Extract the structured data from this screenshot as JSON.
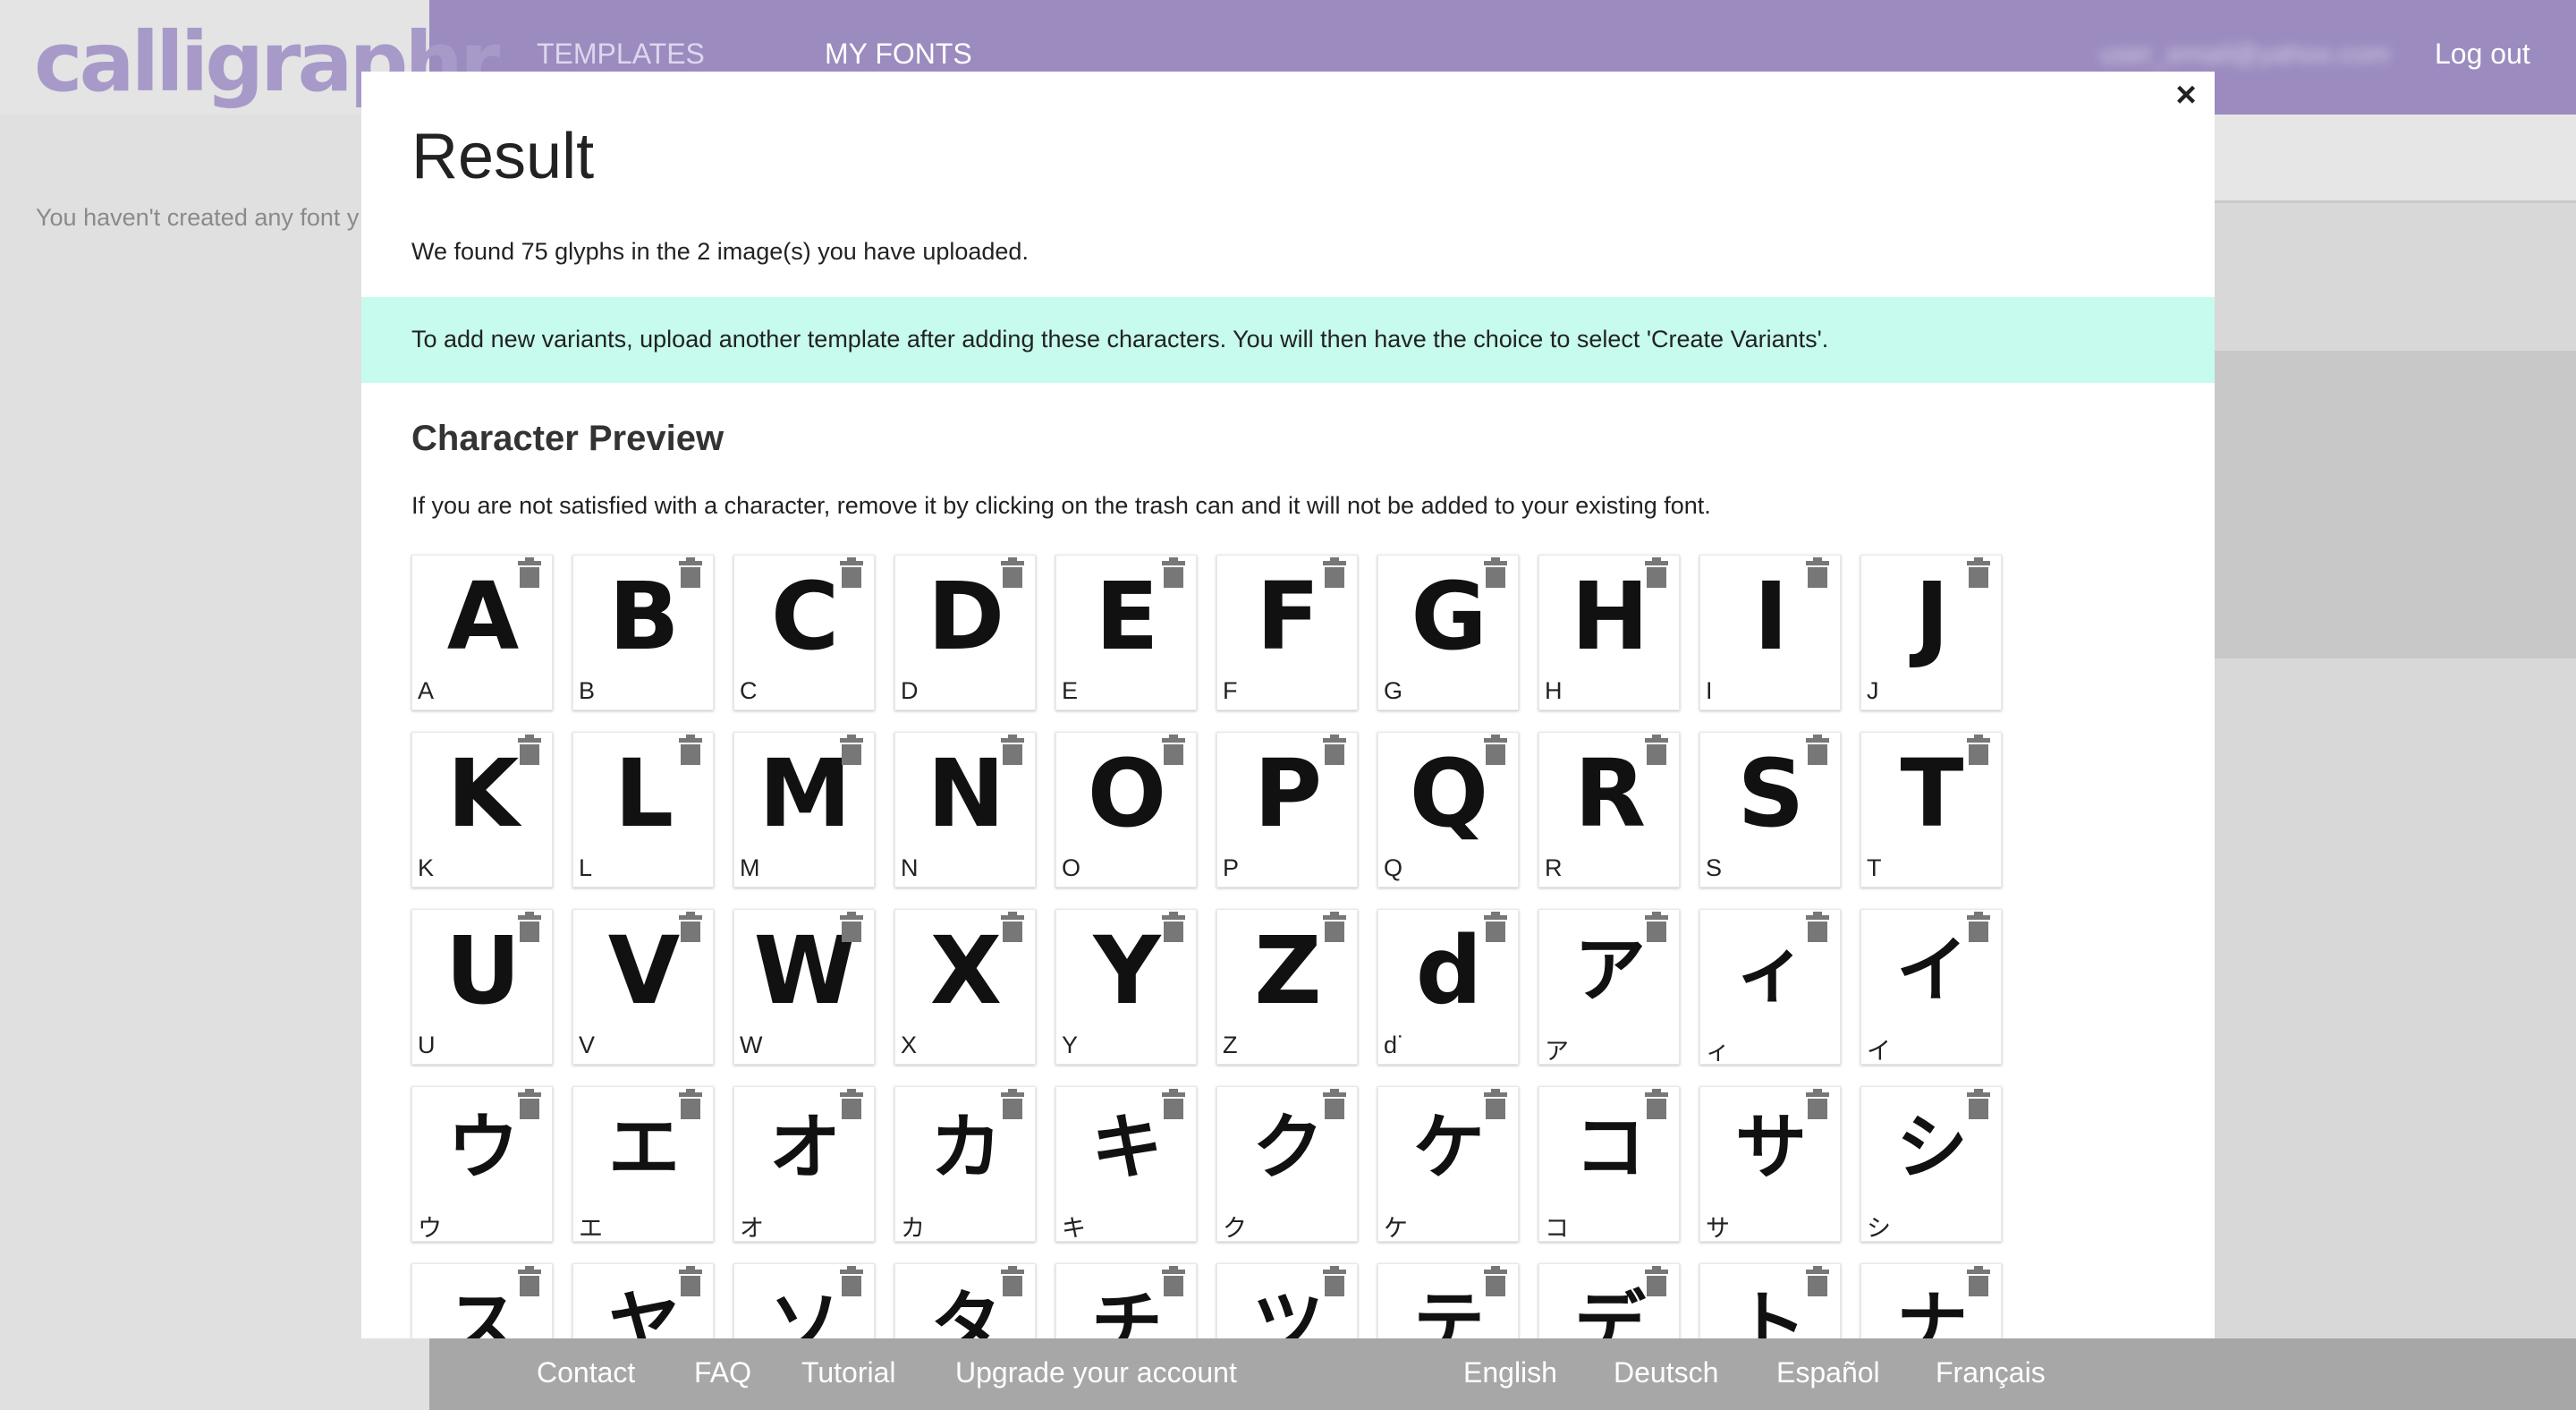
{
  "app": {
    "logo": "calligraphr",
    "nav": {
      "templates": "TEMPLATES",
      "my_fonts": "MY FONTS"
    },
    "user_email": "user_email@yahoo.com",
    "logout": "Log out",
    "empty_message": "You haven't created any font y"
  },
  "modal": {
    "title": "Result",
    "found_text": "We found 75 glyphs in the 2 image(s) you have uploaded.",
    "info_text": "To add new variants, upload another template after adding these characters. You will then have the choice to select 'Create Variants'.",
    "section_title": "Character Preview",
    "hint_text": "If you are not satisfied with a character, remove it by clicking on the trash can and it will not be added to your existing font.",
    "close_icon": "close-icon",
    "glyphs": [
      {
        "glyph": "A",
        "label": "A"
      },
      {
        "glyph": "B",
        "label": "B"
      },
      {
        "glyph": "C",
        "label": "C"
      },
      {
        "glyph": "D",
        "label": "D"
      },
      {
        "glyph": "E",
        "label": "E"
      },
      {
        "glyph": "F",
        "label": "F"
      },
      {
        "glyph": "G",
        "label": "G"
      },
      {
        "glyph": "H",
        "label": "H"
      },
      {
        "glyph": "I",
        "label": "I"
      },
      {
        "glyph": "J",
        "label": "J"
      },
      {
        "glyph": "K",
        "label": "K"
      },
      {
        "glyph": "L",
        "label": "L"
      },
      {
        "glyph": "M",
        "label": "M"
      },
      {
        "glyph": "N",
        "label": "N"
      },
      {
        "glyph": "O",
        "label": "O"
      },
      {
        "glyph": "P",
        "label": "P"
      },
      {
        "glyph": "Q",
        "label": "Q"
      },
      {
        "glyph": "R",
        "label": "R"
      },
      {
        "glyph": "S",
        "label": "S"
      },
      {
        "glyph": "T",
        "label": "T"
      },
      {
        "glyph": "U",
        "label": "U"
      },
      {
        "glyph": "V",
        "label": "V"
      },
      {
        "glyph": "W",
        "label": "W"
      },
      {
        "glyph": "X",
        "label": "X"
      },
      {
        "glyph": "Y",
        "label": "Y"
      },
      {
        "glyph": "Z",
        "label": "Z"
      },
      {
        "glyph": "d",
        "label": "d˙"
      },
      {
        "glyph": "ア",
        "label": "ア"
      },
      {
        "glyph": "ィ",
        "label": "ィ"
      },
      {
        "glyph": "イ",
        "label": "イ"
      },
      {
        "glyph": "ウ",
        "label": "ウ"
      },
      {
        "glyph": "エ",
        "label": "エ"
      },
      {
        "glyph": "オ",
        "label": "オ"
      },
      {
        "glyph": "カ",
        "label": "カ"
      },
      {
        "glyph": "キ",
        "label": "キ"
      },
      {
        "glyph": "ク",
        "label": "ク"
      },
      {
        "glyph": "ケ",
        "label": "ケ"
      },
      {
        "glyph": "コ",
        "label": "コ"
      },
      {
        "glyph": "サ",
        "label": "サ"
      },
      {
        "glyph": "シ",
        "label": "シ"
      },
      {
        "glyph": "ス",
        "label": ""
      },
      {
        "glyph": "ヤ",
        "label": ""
      },
      {
        "glyph": "ソ",
        "label": ""
      },
      {
        "glyph": "タ",
        "label": ""
      },
      {
        "glyph": "チ",
        "label": ""
      },
      {
        "glyph": "ツ",
        "label": ""
      },
      {
        "glyph": "テ",
        "label": ""
      },
      {
        "glyph": "デ",
        "label": ""
      },
      {
        "glyph": "ト",
        "label": ""
      },
      {
        "glyph": "ナ",
        "label": ""
      }
    ]
  },
  "footer": {
    "contact": "Contact",
    "faq": "FAQ",
    "tutorial": "Tutorial",
    "upgrade": "Upgrade your account",
    "english": "English",
    "deutsch": "Deutsch",
    "espanol": "Español",
    "francais": "Français"
  },
  "colors": {
    "header": "#9b8bbf",
    "logo": "#a79ac9",
    "info_box": "#c6fbed",
    "footer": "#a7a7a7",
    "overlay": "#d8d8d8"
  }
}
